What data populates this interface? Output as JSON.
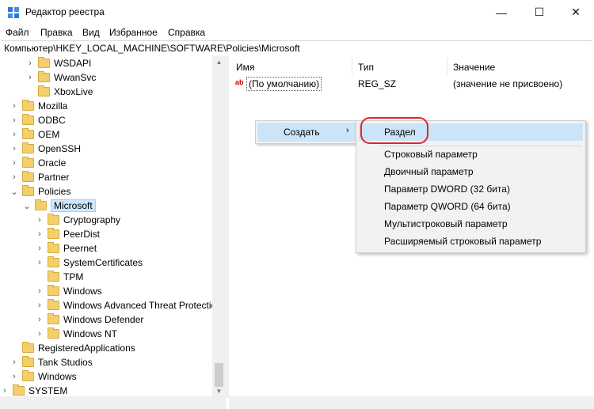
{
  "window": {
    "title": "Редактор реестра",
    "minimize_glyph": "—",
    "maximize_glyph": "☐",
    "close_glyph": "✕"
  },
  "menu": [
    "Файл",
    "Правка",
    "Вид",
    "Избранное",
    "Справка"
  ],
  "address": "Компьютер\\HKEY_LOCAL_MACHINE\\SOFTWARE\\Policies\\Microsoft",
  "tree": [
    {
      "label": "WSDAPI",
      "chev": "›"
    },
    {
      "label": "WwanSvc",
      "chev": "›"
    },
    {
      "label": "XboxLive",
      "chev": ""
    },
    {
      "label": "Mozilla",
      "chev": "›"
    },
    {
      "label": "ODBC",
      "chev": "›"
    },
    {
      "label": "OEM",
      "chev": "›"
    },
    {
      "label": "OpenSSH",
      "chev": "›"
    },
    {
      "label": "Oracle",
      "chev": "›"
    },
    {
      "label": "Partner",
      "chev": "›"
    },
    {
      "label": "Policies",
      "chev": "⌄"
    },
    {
      "label": "Microsoft",
      "chev": "⌄"
    },
    {
      "label": "Cryptography",
      "chev": "›"
    },
    {
      "label": "PeerDist",
      "chev": "›"
    },
    {
      "label": "Peernet",
      "chev": "›"
    },
    {
      "label": "SystemCertificates",
      "chev": "›"
    },
    {
      "label": "TPM",
      "chev": ""
    },
    {
      "label": "Windows",
      "chev": "›"
    },
    {
      "label": "Windows Advanced Threat Protection",
      "chev": "›"
    },
    {
      "label": "Windows Defender",
      "chev": "›"
    },
    {
      "label": "Windows NT",
      "chev": "›"
    },
    {
      "label": "RegisteredApplications",
      "chev": ""
    },
    {
      "label": "Tank Studios",
      "chev": "›"
    },
    {
      "label": "Windows",
      "chev": "›"
    },
    {
      "label": "SYSTEM",
      "chev": "›"
    }
  ],
  "columns": {
    "name": "Имя",
    "type": "Тип",
    "value": "Значение"
  },
  "values": [
    {
      "name": "(По умолчанию)",
      "type": "REG_SZ",
      "data": "(значение не присвоено)",
      "icon": "ab"
    }
  ],
  "context_menu": {
    "create_label": "Создать",
    "submenu_arrow": "›"
  },
  "submenu": [
    "Раздел",
    "Строковый параметр",
    "Двоичный параметр",
    "Параметр DWORD (32 бита)",
    "Параметр QWORD (64 бита)",
    "Мультистроковый параметр",
    "Расширяемый строковый параметр"
  ],
  "scroll": {
    "up_glyph": "▲",
    "down_glyph": "▼"
  },
  "colors": {
    "highlight_ring": "#e3232d",
    "selection": "#cce4f7",
    "folder": "#f4cf6b"
  }
}
